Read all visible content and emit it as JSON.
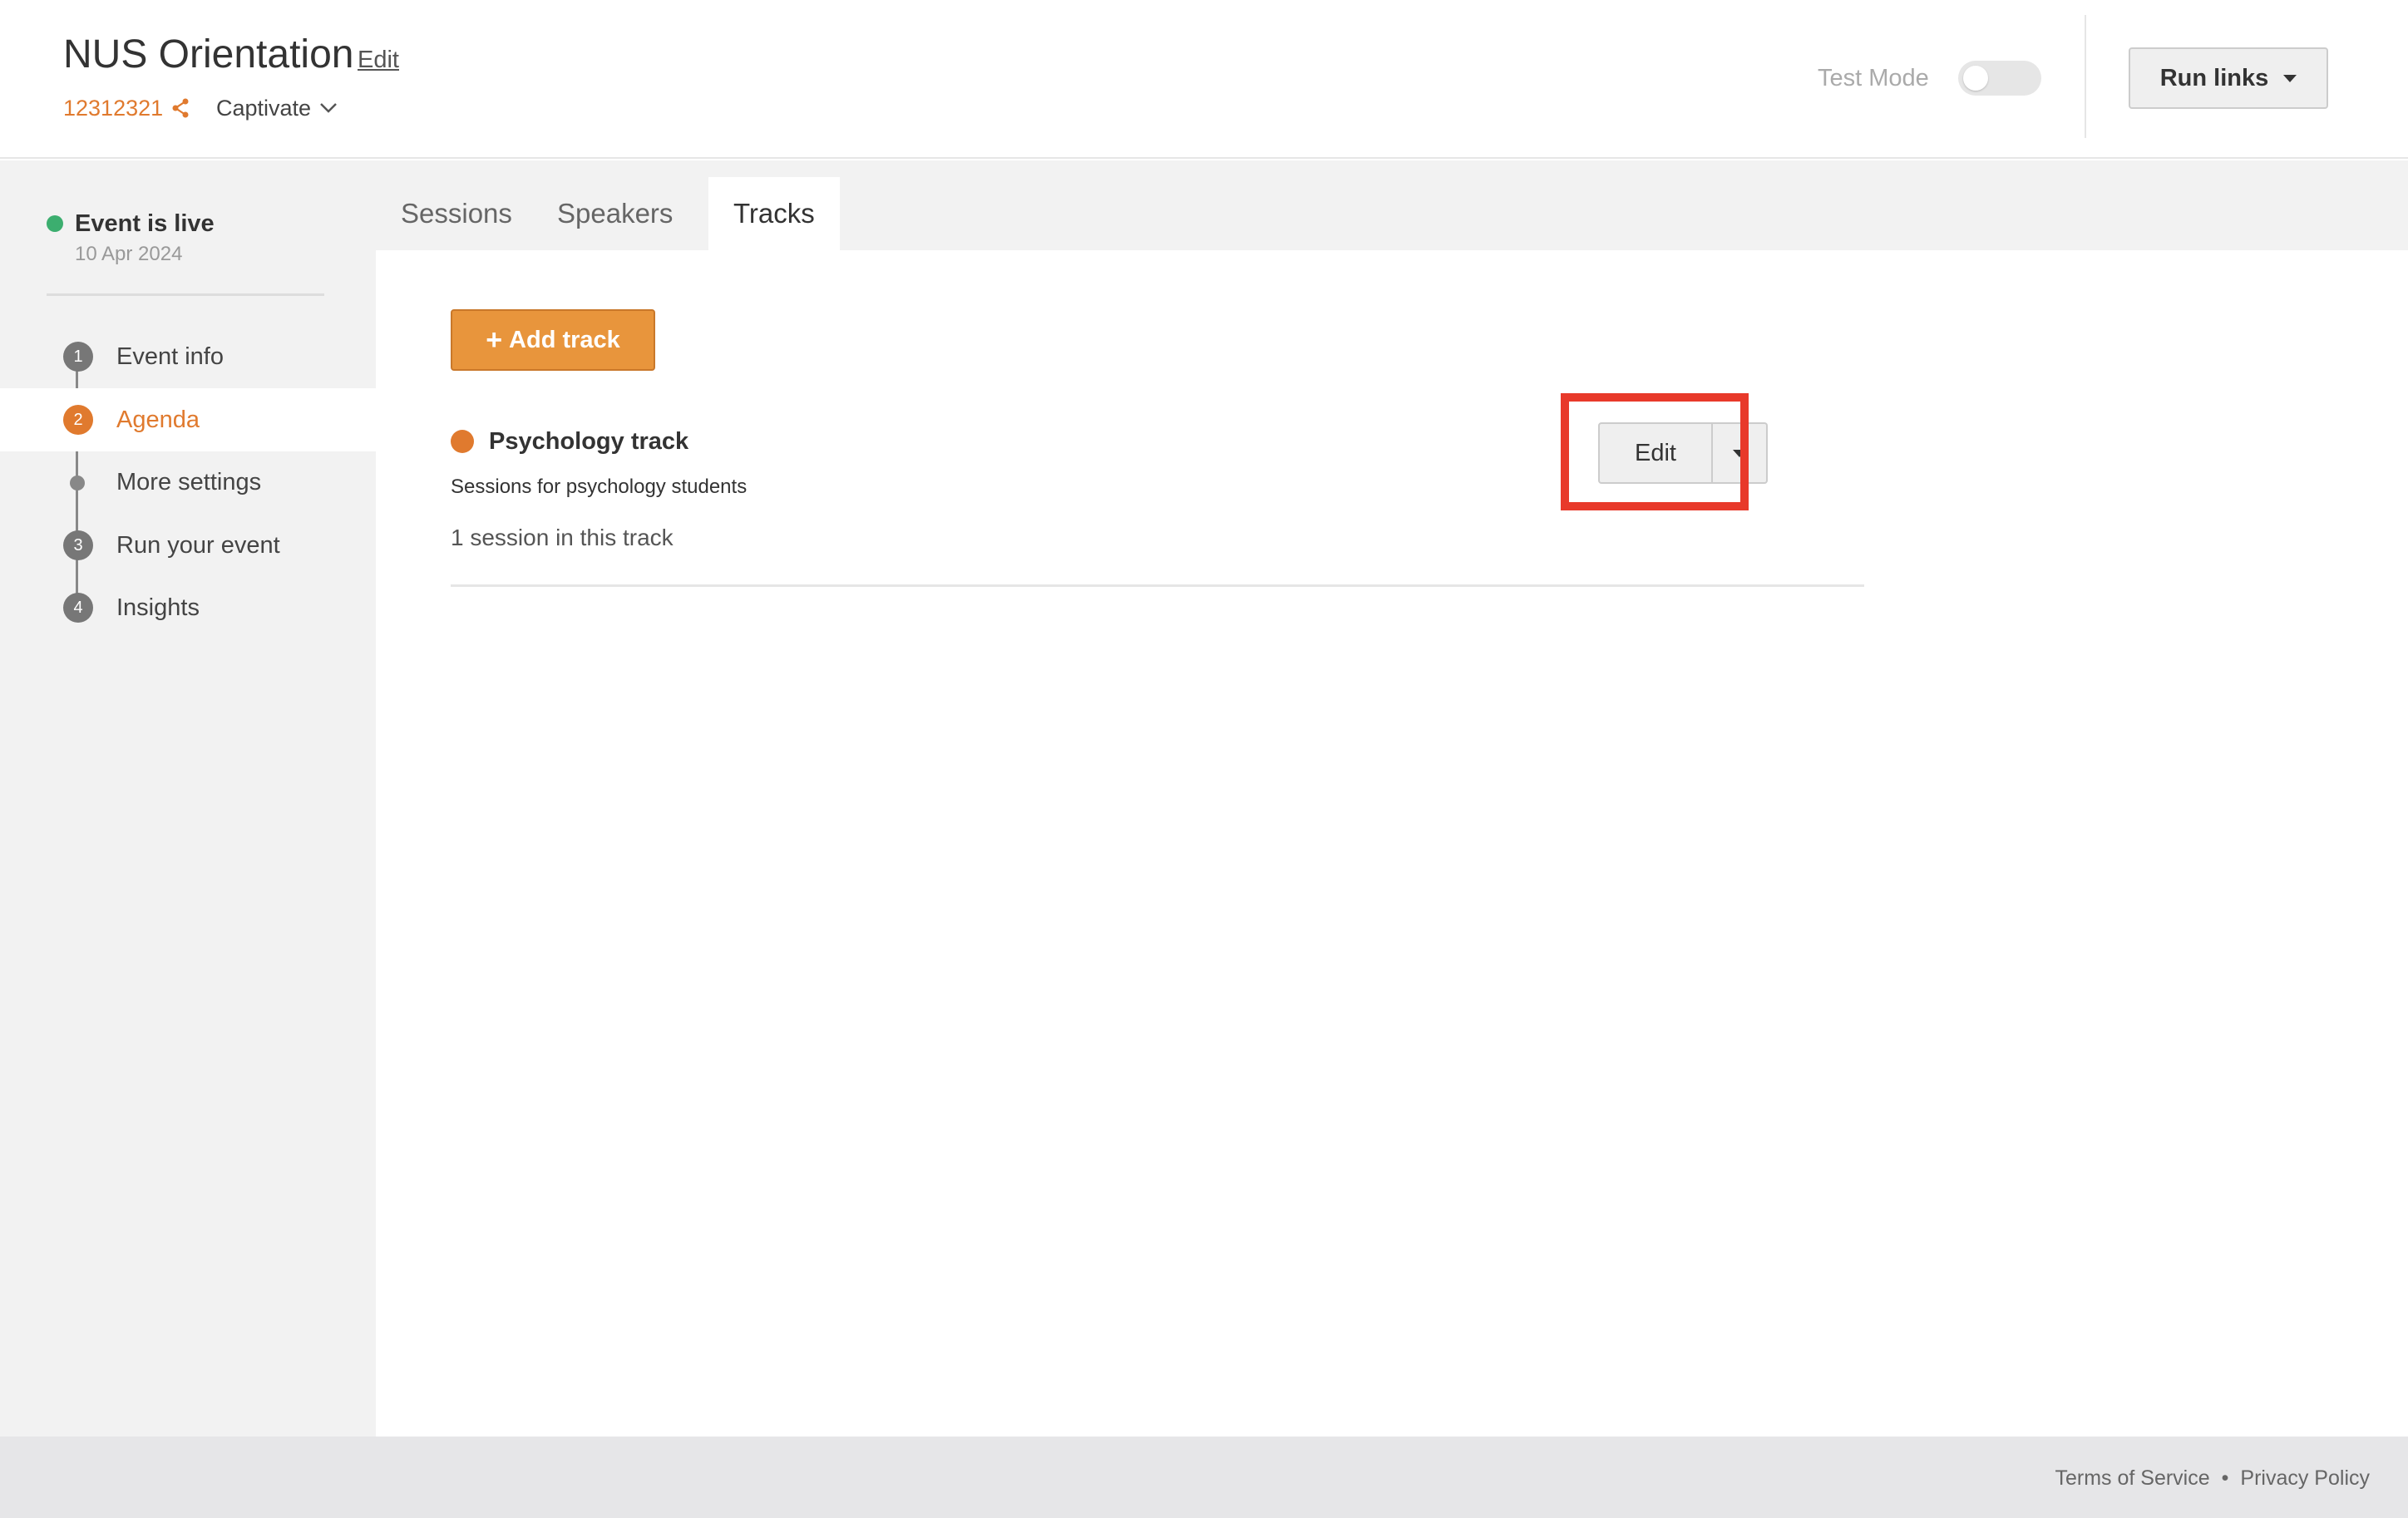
{
  "header": {
    "event_title": "NUS Orientation",
    "title_edit_label": "Edit",
    "event_code": "12312321",
    "org_name": "Captivate",
    "test_mode_label": "Test Mode",
    "test_mode_on": false,
    "run_links_label": "Run links"
  },
  "sidebar": {
    "status": "Event is live",
    "status_date": "10 Apr 2024",
    "items": [
      {
        "step": "1",
        "label": "Event info",
        "active": false
      },
      {
        "step": "2",
        "label": "Agenda",
        "active": true
      },
      {
        "step": "",
        "label": "More settings",
        "active": false
      },
      {
        "step": "3",
        "label": "Run your event",
        "active": false
      },
      {
        "step": "4",
        "label": "Insights",
        "active": false
      }
    ]
  },
  "tabs": [
    {
      "label": "Sessions",
      "active": false
    },
    {
      "label": "Speakers",
      "active": false
    },
    {
      "label": "Tracks",
      "active": true
    }
  ],
  "main": {
    "add_track_label": "Add track",
    "track": {
      "name": "Psychology track",
      "description": "Sessions for psychology students",
      "session_count": "1 session in this track",
      "color": "#e07a2e",
      "edit_label": "Edit"
    }
  },
  "footer": {
    "terms": "Terms of Service",
    "separator": "•",
    "privacy": "Privacy Policy"
  }
}
